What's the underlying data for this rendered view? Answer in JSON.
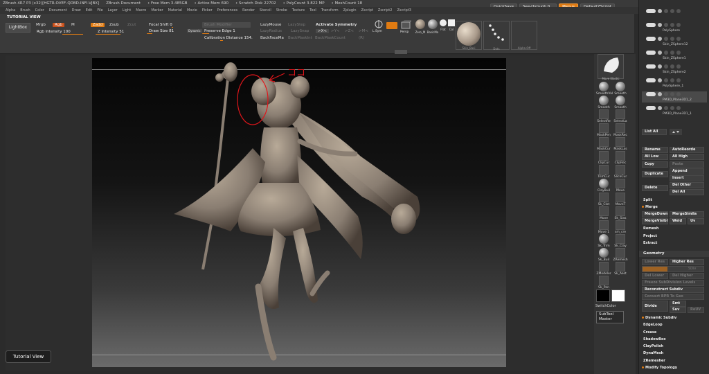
{
  "titlebar": {
    "app": "ZBrush 4R7 P3 (x32)[HGTR-OVEF-QDBD-INFI-VJBX]",
    "doc": "ZBrush Document",
    "free_mem": "• Free Mem 3.485GB",
    "active_mem": "• Active Mem 690",
    "scratch": "• Scratch Disk 22702",
    "polycount": "• PolyCount 3.822 MP",
    "meshcount": "• MeshCount 18"
  },
  "topright": {
    "quicksave": "QuickSave",
    "seethrough": "See-through",
    "seethrough_val": "0",
    "menus": "Menus",
    "default_script": "DefaultZScript"
  },
  "menu": [
    "Alpha",
    "Brush",
    "Color",
    "Document",
    "Draw",
    "Edit",
    "File",
    "Layer",
    "Light",
    "Macro",
    "Marker",
    "Material",
    "Movie",
    "Picker",
    "Preferences",
    "Render",
    "Stencil",
    "Stroke",
    "Texture",
    "Tool",
    "Transform",
    "Zplugin",
    "Zscript",
    "Zscript2",
    "Zscript3"
  ],
  "toolbar": {
    "tutorial_view": "TUTORIAL VIEW",
    "lightbox": "LightBox",
    "mrgb": "Mrgb",
    "rgb": "Rgb",
    "m": "M",
    "rgb_intensity": "Rgb Intensity 100",
    "zadd": "Zadd",
    "zsub": "Zsub",
    "zcut": "Zcut",
    "z_intensity": "Z Intensity 51",
    "focal_shift": "Focal Shift 0",
    "draw_size": "Draw Size 81",
    "dynamic": "Dynamic",
    "brush_modifier": "Brush Modifier",
    "preserve_edge": "Preserve Edge 1",
    "calibration": "Calibration Distance 154.",
    "lazymouse": "LazyMouse",
    "lazystep": "LazyStep",
    "lazyradius": "LazyRadius",
    "lazysnap": "LazySnap",
    "backfacemask": "BackFaceMa",
    "backmaskint": "BackMaskInt",
    "backmaskcount": "BackMaskCount",
    "activate_symmetry": "Activate Symmetry",
    "sym_x": ">X<",
    "sym_y": ">Y<",
    "sym_z": ">Z<",
    "sym_m": ">M<",
    "sym_r": "(R)",
    "lsym": "L.Sym",
    "persp_label": "Persp",
    "mat1": "Zero_M",
    "mat2": "BasicMa",
    "mat3": "Flat",
    "mat4": "Col",
    "thumb1": "Skin_Basi",
    "thumb2": "Dots",
    "thumb3": "Alpha Off"
  },
  "viewport": {
    "annotation": "ココ",
    "tutorial_button": "Tutorial View"
  },
  "shelf": {
    "top_label": "Move Elastic",
    "buttons": [
      "SmoothVal",
      "Smooth",
      "Smooth",
      "Smooth",
      "SelectRe",
      "SelectLa",
      "MaskPen",
      "MaskRec",
      "MaskCur",
      "MaskLas",
      "ClipCur",
      "ClipRec",
      "TrimCur",
      "SliceCur",
      "ClayBuil",
      "Move",
      "Sk_Clot",
      "MoveT",
      "Move",
      "Sk_Slas",
      "Move 1",
      "sm_cre",
      "Sk_Trim",
      "Sk_Clay",
      "Sk_Buil",
      "ZRemesh",
      "ZModeler",
      "Sk_Aest",
      "Sk_Pen"
    ],
    "switch_color": "SwitchColor",
    "subtool_master": "SubTool Master"
  },
  "subtools": [
    "",
    "PolySphere",
    "Skin_ZSphere12",
    "Skin_ZSphere1",
    "Skin_ZSphere2",
    "PolySphere_1",
    "PM3D_Plane3D1_2",
    "PM3D_Plane3D1_1"
  ],
  "subtool_panel": {
    "list_all": "List All",
    "rename": "Rename",
    "autoreorder": "AutoReorde",
    "all_low": "All Low",
    "all_high": "All High",
    "copy": "Copy",
    "paste": "Paste",
    "append": "Append",
    "duplicate": "Duplicate",
    "insert": "Insert",
    "delete": "Delete",
    "del_other": "Del Other",
    "del_all": "Del All",
    "split": "Split",
    "merge": "Merge",
    "mergedown": "MergeDown",
    "mergesimilar": "MergeSimila",
    "mergevisible": "MergeVisible",
    "weld": "Weld",
    "uv": "Uv",
    "remesh": "Remesh",
    "project": "Project",
    "extract": "Extract"
  },
  "geometry": {
    "header": "Geometry",
    "lower_res": "Lower Res",
    "higher_res": "Higher Res",
    "sdiv": "SDiv",
    "del_lower": "Del Lower",
    "del_higher": "Del Higher",
    "freeze": "Freeze SubDivision Levels",
    "reconstruct": "Reconstruct Subdiv",
    "convert_bpr": "Convert BPR To Geo",
    "divide": "Divide",
    "smt": "Smt",
    "suv": "Suv",
    "rsmt": "ReUV",
    "dynamic_subdiv": "Dynamic Subdiv",
    "edgeloop": "EdgeLoop",
    "crease": "Crease",
    "shadowbox": "ShadowBox",
    "claypolish": "ClayPolish",
    "dynamesh": "DynaMesh",
    "zremesher": "ZRemesher",
    "modify_topology": "Modify Topology"
  },
  "colors": {
    "accent": "#e07b12",
    "annotation": "#e0161b",
    "model": "#8a7e72"
  }
}
